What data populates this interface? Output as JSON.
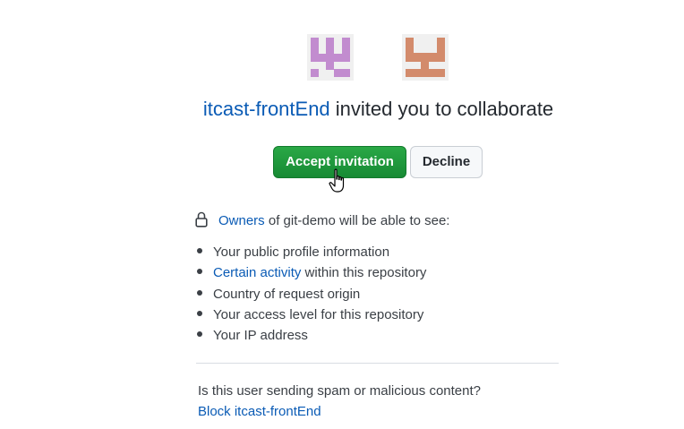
{
  "avatars": [
    {
      "name": "org-identicon",
      "color": "#c28ccf"
    },
    {
      "name": "user-identicon",
      "color": "#d38b6c"
    }
  ],
  "invite": {
    "org_name": "itcast-frontEnd",
    "message": "invited you to collaborate"
  },
  "actions": {
    "accept_label": "Accept invitation",
    "decline_label": "Decline"
  },
  "owners": {
    "icon": "lock-icon",
    "link_text": "Owners",
    "text": "of git-demo will be able to see:"
  },
  "permissions": [
    {
      "text": "Your public profile information"
    },
    {
      "link": "Certain activity",
      "text": "within this repository"
    },
    {
      "text": "Country of request origin"
    },
    {
      "text": "Your access level for this repository"
    },
    {
      "text": "Your IP address"
    }
  ],
  "spam": {
    "question": "Is this user sending spam or malicious content?",
    "block_label": "Block itcast-frontEnd"
  },
  "colors": {
    "link": "#0a5bb5",
    "accept_green": "#1f9a3c"
  }
}
